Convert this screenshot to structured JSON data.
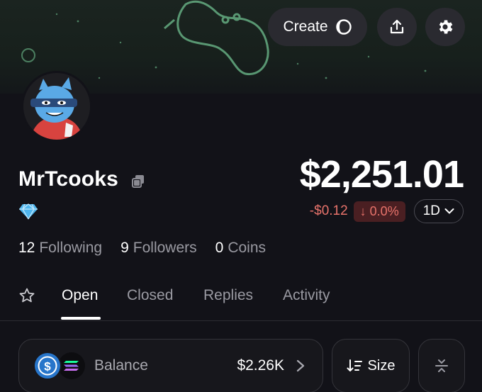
{
  "header": {
    "create_label": "Create",
    "icons": [
      "create-spinner-icon",
      "upload-icon",
      "gear-icon"
    ]
  },
  "profile": {
    "username": "MrTcooks",
    "badge_icon": "diamond-icon",
    "copy_icon": "copy-icon"
  },
  "portfolio": {
    "balance": "$2,251.01",
    "change_amount": "-$0.12",
    "change_percent": "↓ 0.0%",
    "period": "1D",
    "negative_color": "#e8736b"
  },
  "stats": [
    {
      "count": "12",
      "label": "Following"
    },
    {
      "count": "9",
      "label": "Followers"
    },
    {
      "count": "0",
      "label": "Coins"
    }
  ],
  "tabs": [
    {
      "label": "Open",
      "active": true
    },
    {
      "label": "Closed",
      "active": false
    },
    {
      "label": "Replies",
      "active": false
    },
    {
      "label": "Activity",
      "active": false
    }
  ],
  "balance_card": {
    "label": "Balance",
    "amount": "$2.26K",
    "icons": [
      "usdc-coin-icon",
      "solana-coin-icon"
    ]
  },
  "sort_button": {
    "label": "Size"
  }
}
